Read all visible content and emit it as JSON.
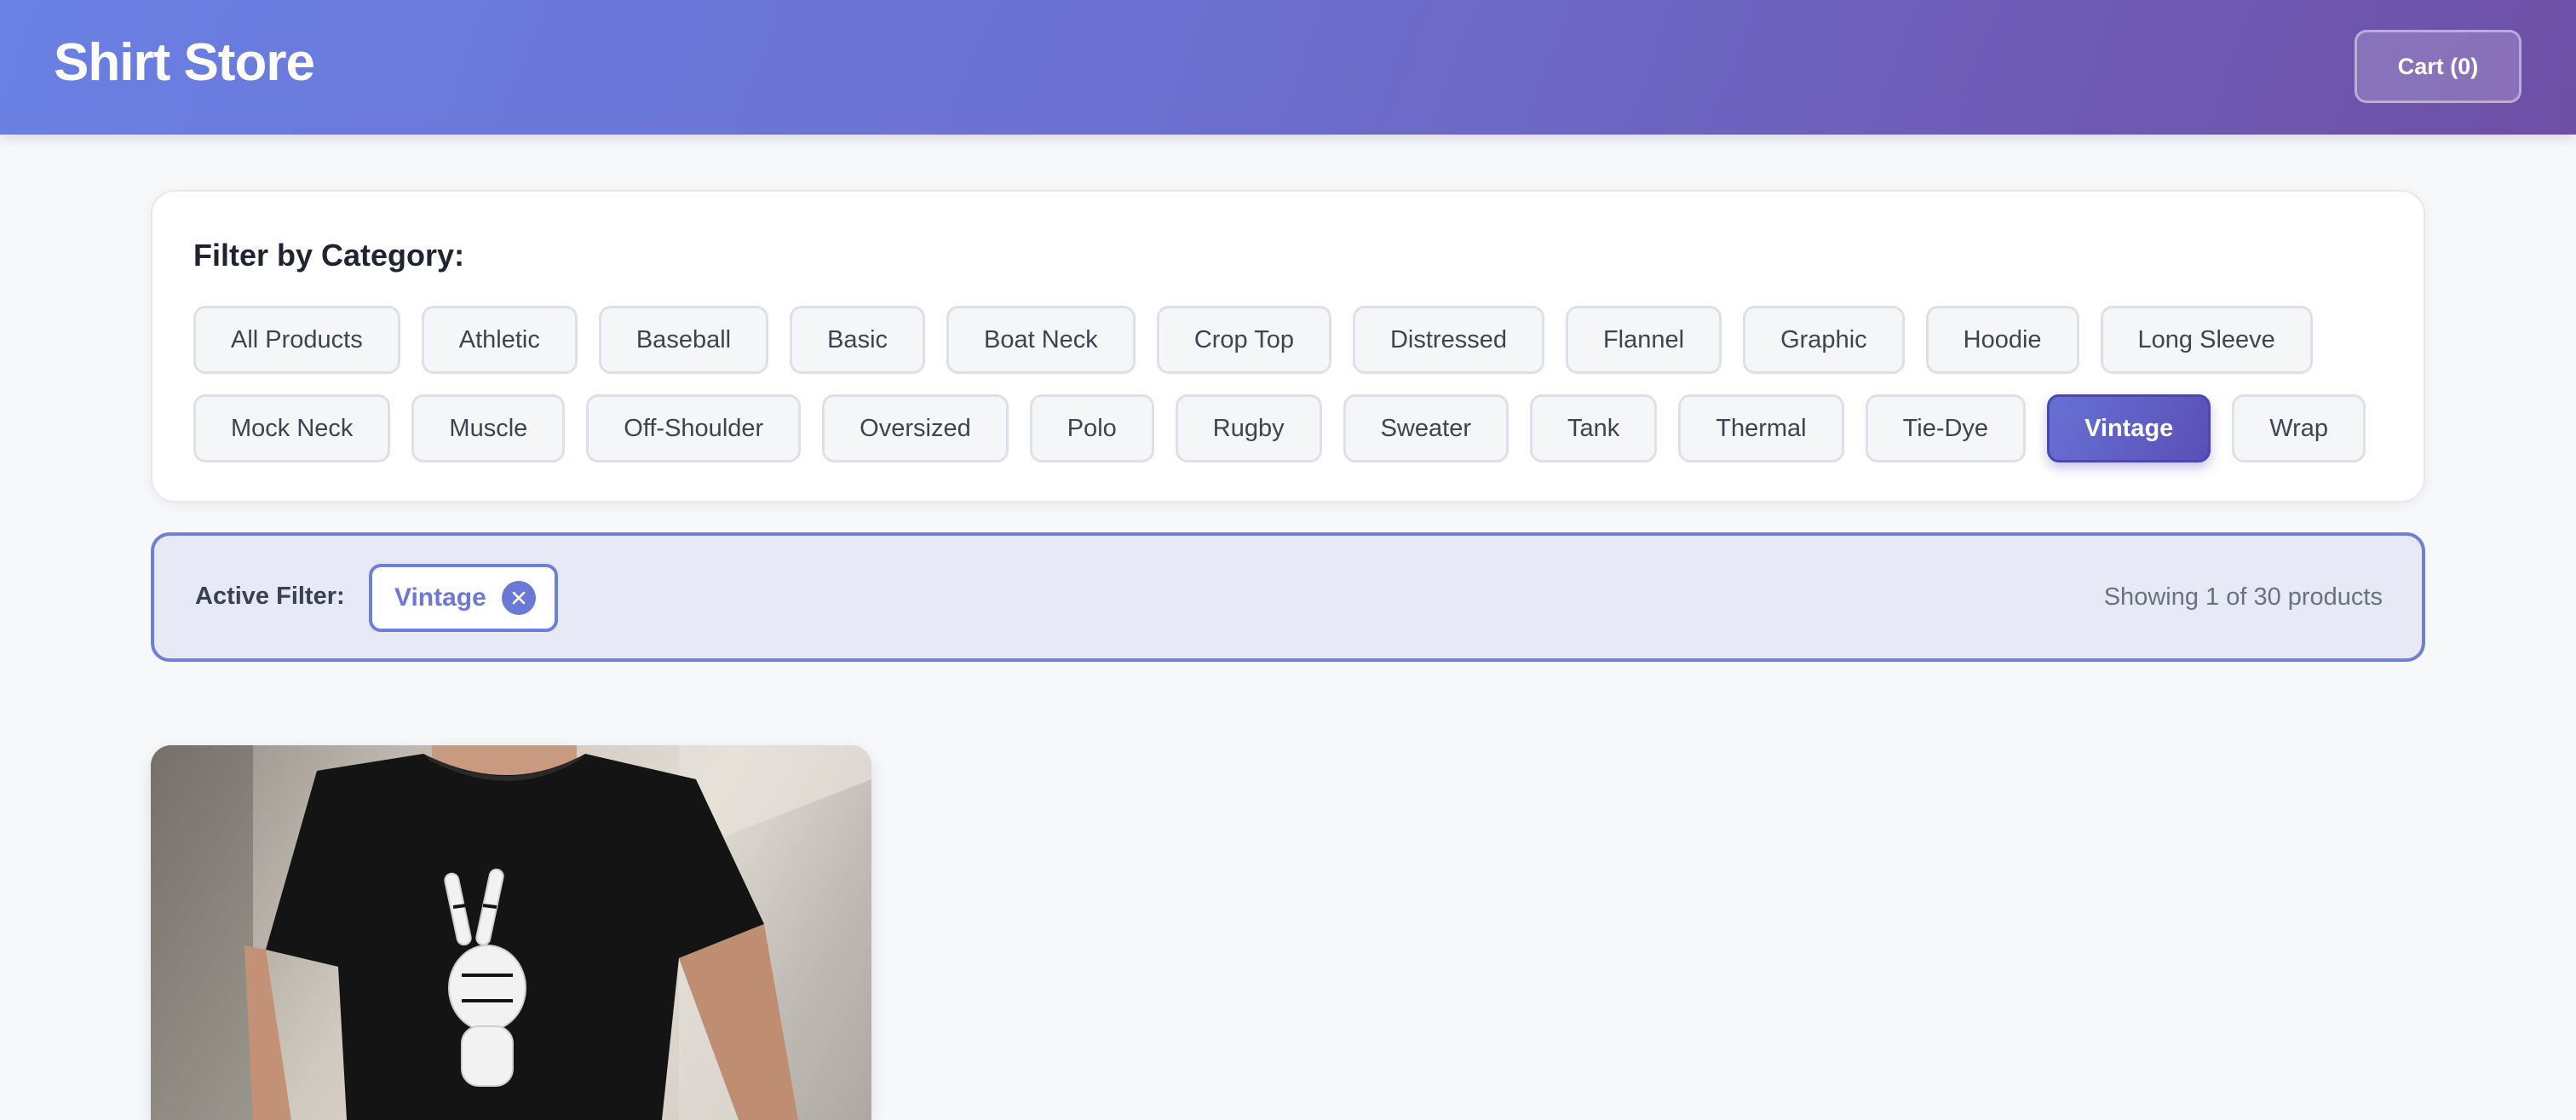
{
  "header": {
    "brand": "Shirt Store",
    "cart_label": "Cart (0)"
  },
  "filter": {
    "title": "Filter by Category:",
    "row1": [
      "All Products",
      "Athletic",
      "Baseball",
      "Basic",
      "Boat Neck",
      "Crop Top",
      "Distressed",
      "Flannel",
      "Graphic",
      "Hoodie",
      "Long Sleeve"
    ],
    "row2": [
      "Mock Neck",
      "Muscle",
      "Off-Shoulder",
      "Oversized",
      "Polo",
      "Rugby",
      "Sweater",
      "Tank",
      "Thermal",
      "Tie-Dye",
      "Vintage",
      "Wrap"
    ],
    "selected": "Vintage"
  },
  "active_filter": {
    "label": "Active Filter:",
    "value": "Vintage",
    "clear_icon": "close-icon",
    "results_text": "Showing 1 of 30 products"
  },
  "products": [
    {
      "image": "black-tshirt-skeleton-peace-hand-graphic"
    }
  ],
  "colors": {
    "header_gradient_start": "#6a80e3",
    "header_gradient_end": "#6f4fa6",
    "accent": "#6e7fd9",
    "active_chip": "#5a4fb7",
    "page_bg": "#f7f8fa"
  }
}
